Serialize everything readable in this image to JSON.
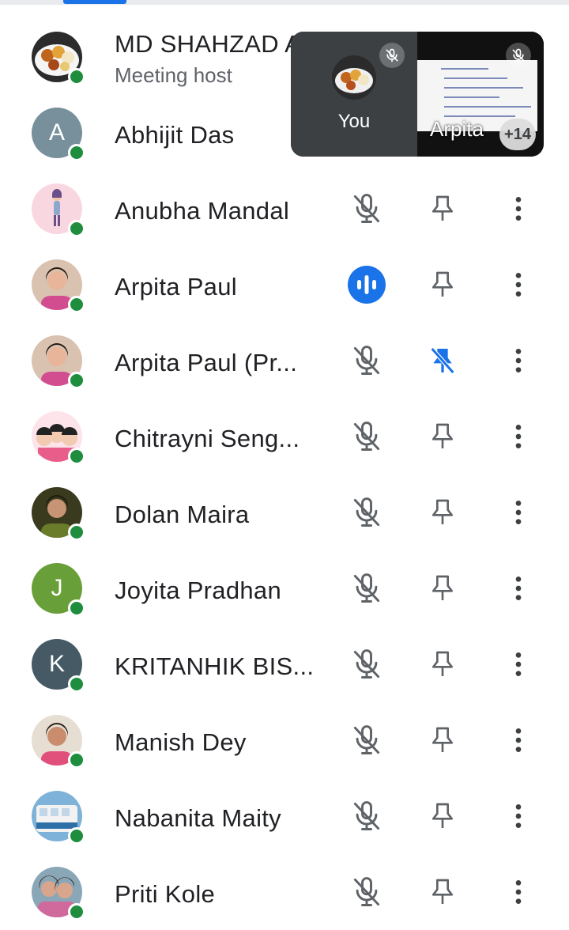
{
  "participants": [
    {
      "name": "MD SHAHZAD A",
      "subtitle": "Meeting host",
      "avatar_type": "photo",
      "avatar_desc": "food-plate",
      "online": true
    },
    {
      "name": "Abhijit Das",
      "initial": "A",
      "avatar_type": "initial",
      "avatar_color": "#78909c",
      "online": true
    },
    {
      "name": "Anubha Mandal",
      "avatar_type": "photo",
      "avatar_desc": "cartoon-girl",
      "online": true,
      "mic": "muted",
      "pin": "unpinned"
    },
    {
      "name": "Arpita Paul",
      "avatar_type": "photo",
      "avatar_desc": "portrait",
      "online": true,
      "mic": "speaking",
      "pin": "unpinned"
    },
    {
      "name": "Arpita Paul (Pr...",
      "avatar_type": "photo",
      "avatar_desc": "portrait",
      "online": true,
      "mic": "muted",
      "pin": "pinned"
    },
    {
      "name": "Chitrayni Seng...",
      "avatar_type": "photo",
      "avatar_desc": "cartoon-group",
      "online": true,
      "mic": "muted",
      "pin": "unpinned"
    },
    {
      "name": "Dolan Maira",
      "avatar_type": "photo",
      "avatar_desc": "portrait-dark",
      "online": true,
      "mic": "muted",
      "pin": "unpinned"
    },
    {
      "name": "Joyita Pradhan",
      "initial": "J",
      "avatar_type": "initial",
      "avatar_color": "#689f38",
      "online": true,
      "mic": "muted",
      "pin": "unpinned"
    },
    {
      "name": "KRITANHIK BIS...",
      "initial": "K",
      "avatar_type": "initial",
      "avatar_color": "#455a64",
      "online": true,
      "mic": "muted",
      "pin": "unpinned"
    },
    {
      "name": "Manish Dey",
      "avatar_type": "photo",
      "avatar_desc": "portrait-boy",
      "online": true,
      "mic": "muted",
      "pin": "unpinned"
    },
    {
      "name": "Nabanita Maity",
      "avatar_type": "photo",
      "avatar_desc": "tram",
      "online": true,
      "mic": "muted",
      "pin": "unpinned"
    },
    {
      "name": "Priti Kole",
      "avatar_type": "photo",
      "avatar_desc": "portrait-pair",
      "online": true,
      "mic": "muted",
      "pin": "unpinned"
    }
  ],
  "pip": {
    "self_label": "You",
    "other_label": "Arpita",
    "more_count": "+14"
  },
  "colors": {
    "accent": "#1a73e8",
    "online": "#1e8e3e",
    "icon": "#5f6368",
    "pip_bg": "#3c4043"
  },
  "icons": {
    "muted": "mic-off-icon",
    "speaking": "speaking-icon",
    "pin": "pin-icon",
    "pinned": "pinned-icon",
    "more": "more-vert-icon"
  }
}
